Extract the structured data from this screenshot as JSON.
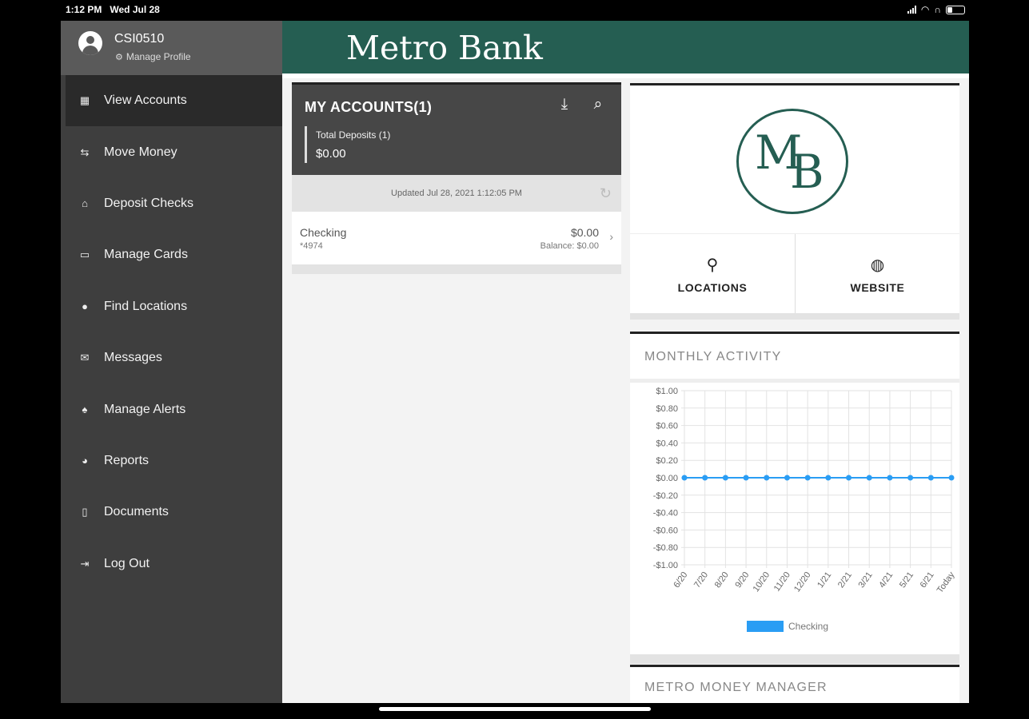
{
  "status_bar": {
    "time": "1:12 PM",
    "date": "Wed Jul 28"
  },
  "profile": {
    "username": "CSI0510",
    "manage_label": "Manage Profile"
  },
  "nav": [
    {
      "label": "View Accounts",
      "icon": "accounts-icon",
      "glyph": "▦",
      "active": true
    },
    {
      "label": "Move Money",
      "icon": "transfer-icon",
      "glyph": "⇆"
    },
    {
      "label": "Deposit Checks",
      "icon": "bank-icon",
      "glyph": "⌂"
    },
    {
      "label": "Manage Cards",
      "icon": "cards-icon",
      "glyph": "▭"
    },
    {
      "label": "Find Locations",
      "icon": "location-pin-icon",
      "glyph": "●"
    },
    {
      "label": "Messages",
      "icon": "envelope-icon",
      "glyph": "✉"
    },
    {
      "label": "Manage Alerts",
      "icon": "bell-icon",
      "glyph": "♠"
    },
    {
      "label": "Reports",
      "icon": "pie-chart-icon",
      "glyph": "◕"
    },
    {
      "label": "Documents",
      "icon": "document-icon",
      "glyph": "▯"
    },
    {
      "label": "Log Out",
      "icon": "logout-icon",
      "glyph": "⇥"
    }
  ],
  "header": {
    "brand": "Metro Bank"
  },
  "accounts": {
    "title": "MY ACCOUNTS(1)",
    "total_label": "Total Deposits (1)",
    "total_amount": "$0.00",
    "updated": "Updated Jul 28, 2021 1:12:05 PM",
    "rows": [
      {
        "name": "Checking",
        "number": "*4974",
        "amount": "$0.00",
        "balance": "Balance: $0.00"
      }
    ]
  },
  "logo": {
    "m": "M",
    "b": "B"
  },
  "quick_links": {
    "locations": "LOCATIONS",
    "website": "WEBSITE"
  },
  "activity": {
    "title": "MONTHLY ACTIVITY"
  },
  "money_manager": {
    "title": "METRO MONEY MANAGER"
  },
  "colors": {
    "brand_green": "#255e52",
    "series_blue": "#2a9df4",
    "sidebar": "#3e3e3e"
  },
  "chart_data": {
    "type": "line",
    "categories": [
      "6/20",
      "7/20",
      "8/20",
      "9/20",
      "10/20",
      "11/20",
      "12/20",
      "1/21",
      "2/21",
      "3/21",
      "4/21",
      "5/21",
      "6/21",
      "Today"
    ],
    "series": [
      {
        "name": "Checking",
        "values": [
          0,
          0,
          0,
          0,
          0,
          0,
          0,
          0,
          0,
          0,
          0,
          0,
          0,
          0
        ]
      }
    ],
    "y_ticks": [
      "$1.00",
      "$0.80",
      "$0.60",
      "$0.40",
      "$0.20",
      "$0.00",
      "-$0.20",
      "-$0.40",
      "-$0.60",
      "-$0.80",
      "-$1.00"
    ],
    "ylim": [
      -1,
      1
    ],
    "grid": true,
    "legend": "bottom-center"
  }
}
